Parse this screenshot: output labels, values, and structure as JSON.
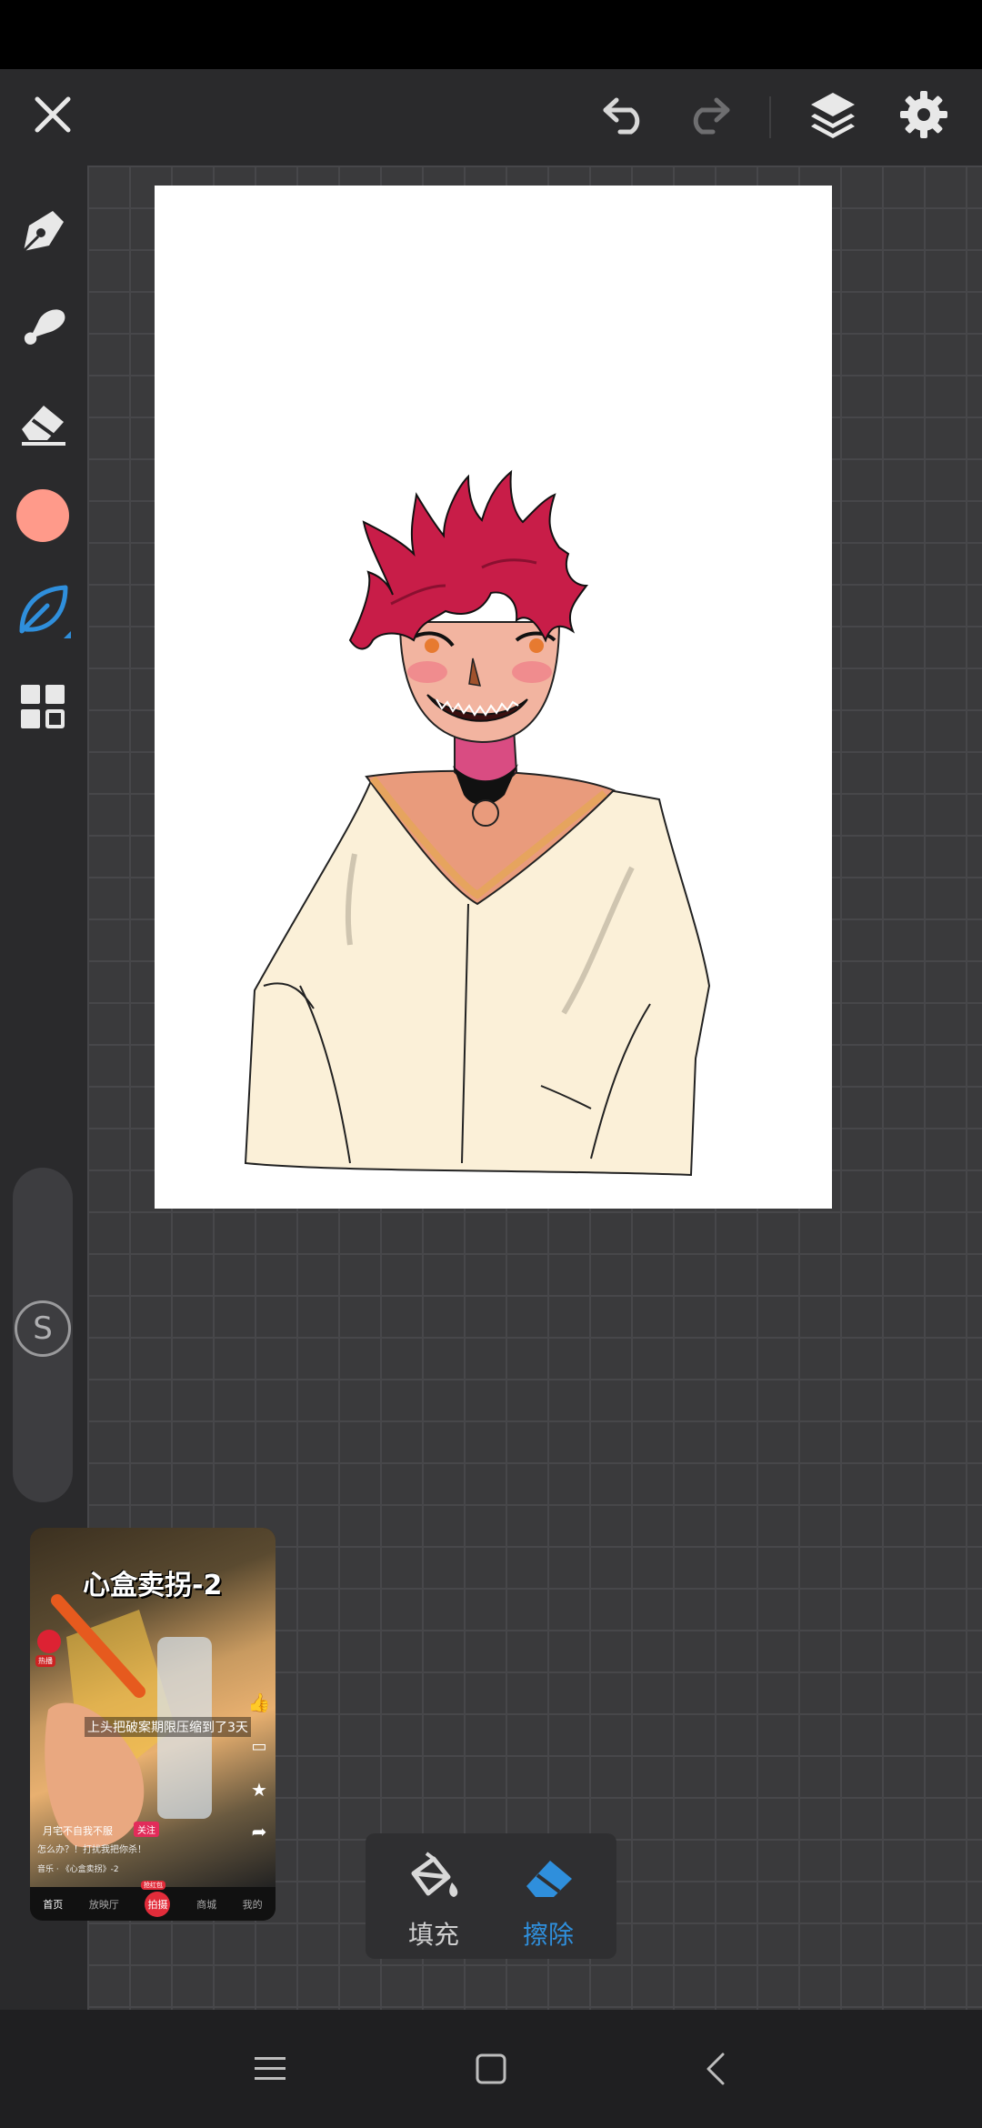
{
  "top_bar": {
    "close_icon": "close-icon",
    "undo_icon": "undo-icon",
    "redo_icon": "redo-icon",
    "layers_icon": "layers-icon",
    "settings_icon": "gear-icon"
  },
  "left_tools": {
    "items": [
      "pen-tool-icon",
      "smudge-brush-icon",
      "eraser-icon",
      "color-swatch",
      "leaf-brush-icon",
      "grid-menu-icon"
    ],
    "color_hex": "#ff9a8a",
    "active_accent": "#2f8fdc"
  },
  "side_slider": {
    "badge": "S"
  },
  "fill_erase": {
    "fill_label": "填充",
    "erase_label": "擦除",
    "active": "擦除"
  },
  "video_float": {
    "title": "心盒卖拐-2",
    "caption": "上头把破案期限压缩到了3天",
    "author_line": "月宅不自我不服",
    "author_tag": "关注",
    "sub_line": "怎么办？！打扰我把你杀！",
    "music_line": "音乐 · 《心盒卖拐》-2",
    "tabs": [
      "首页",
      "放映厅",
      "拍摄",
      "商城",
      "我的"
    ],
    "center_badge": "抢红包",
    "avatar_badge": "热播"
  },
  "nav_bar": {
    "menu_icon": "menu-icon",
    "home_icon": "home-square-icon",
    "back_icon": "back-chevron-icon"
  }
}
